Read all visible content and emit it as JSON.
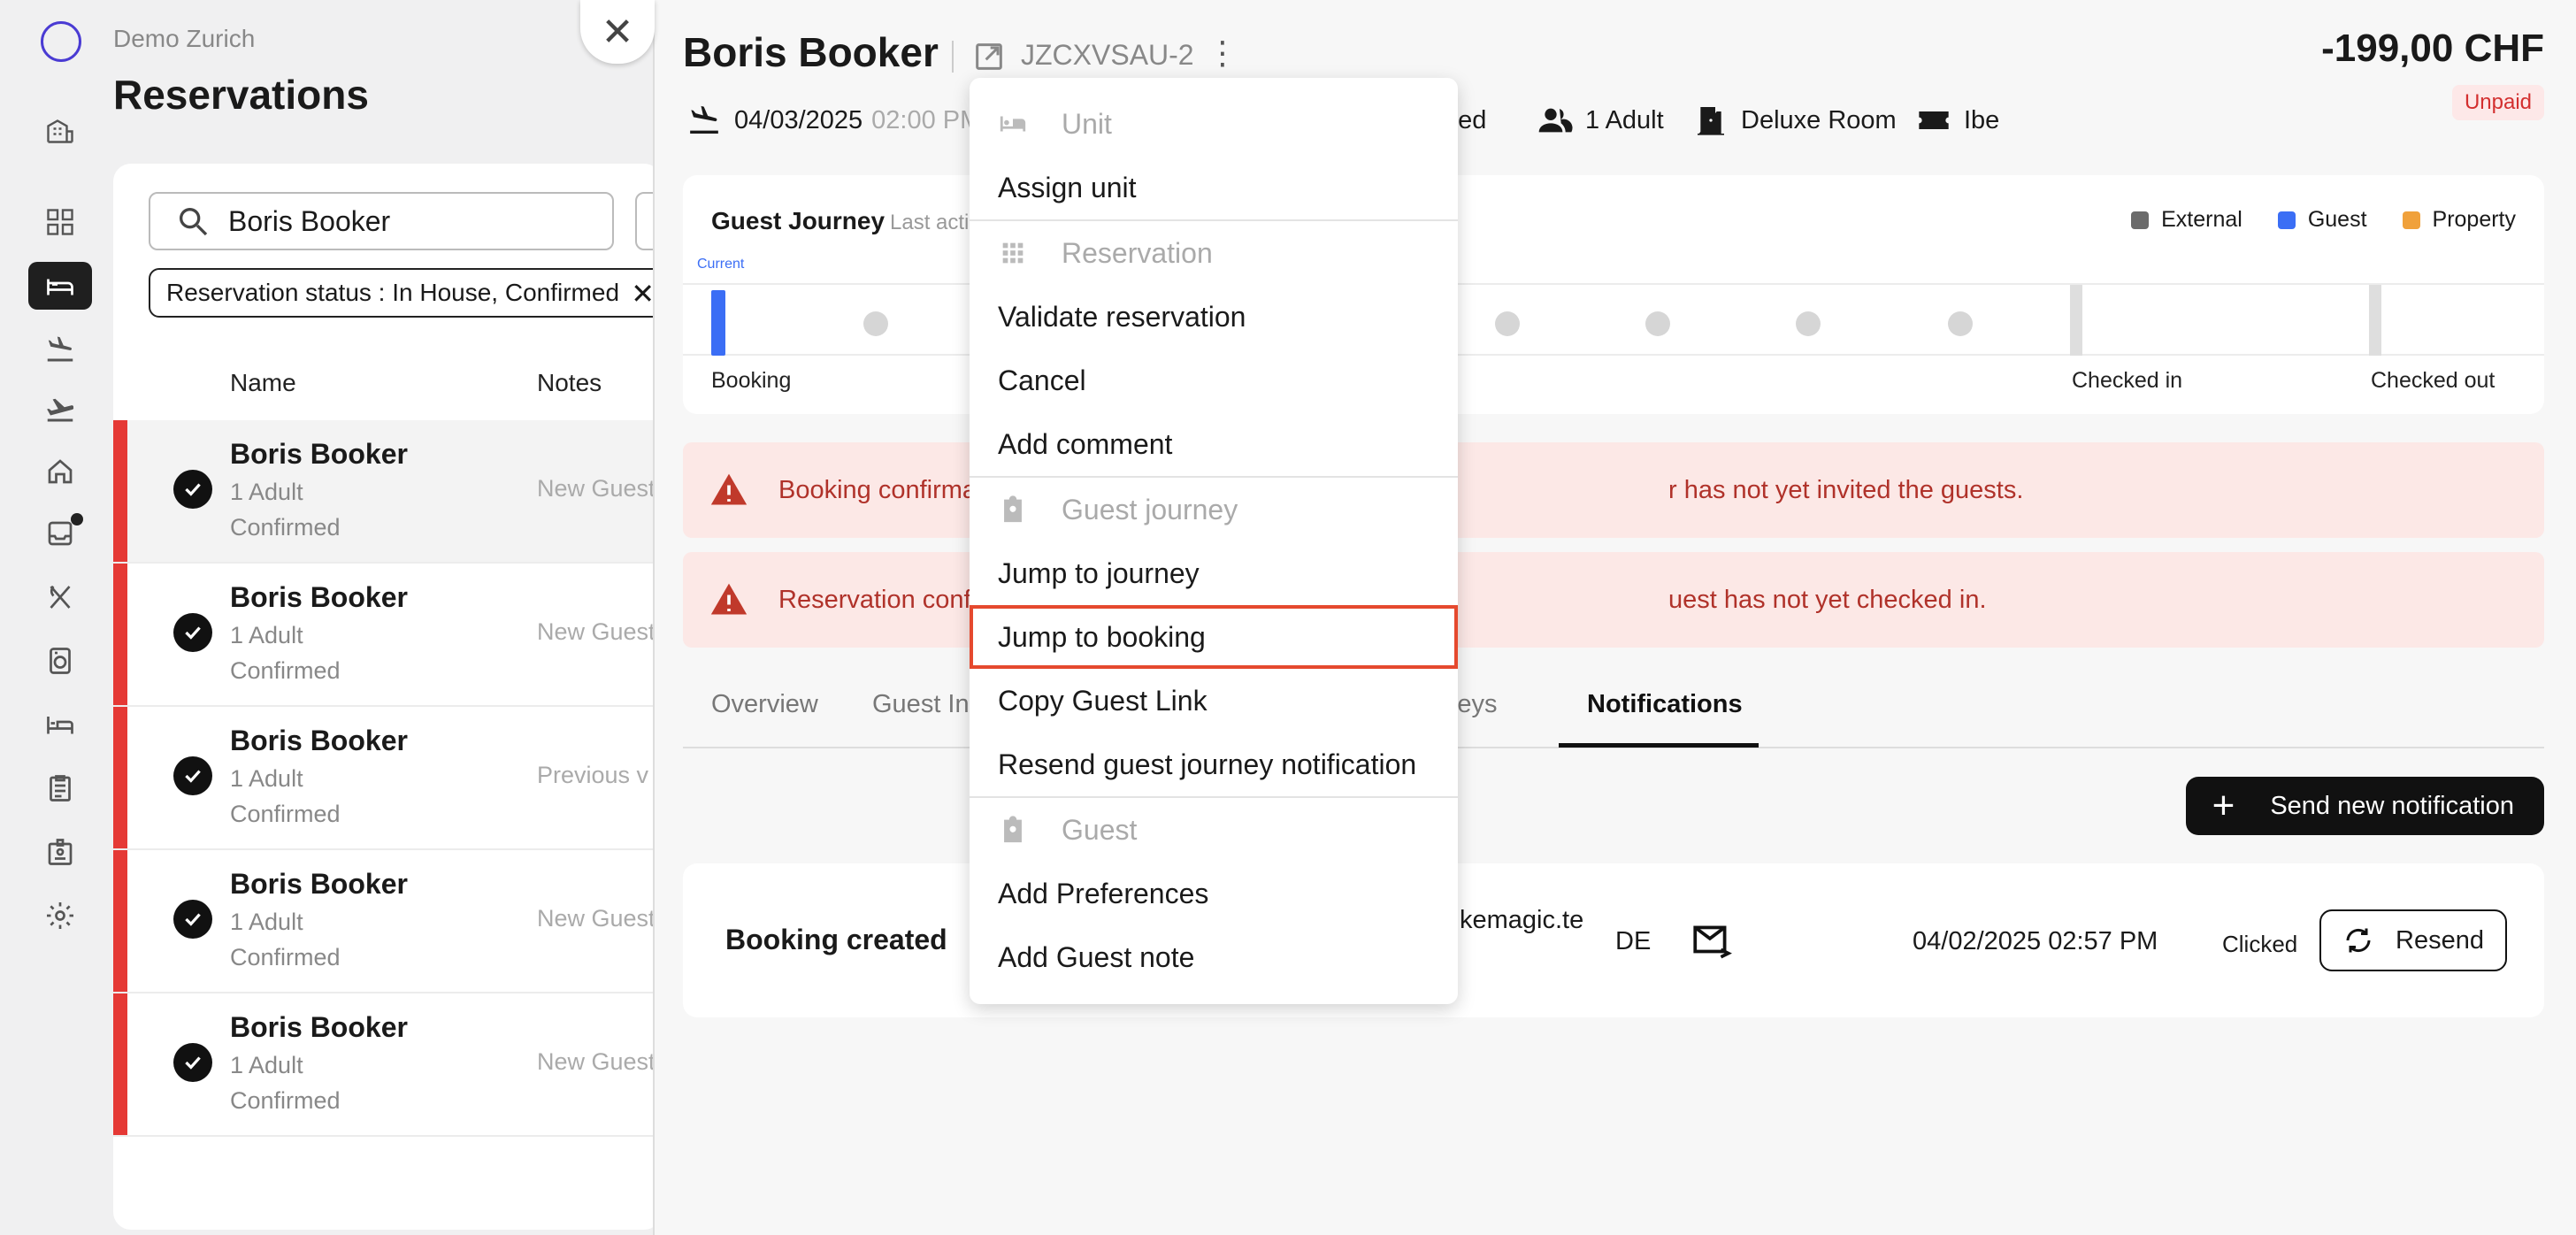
{
  "app": {
    "hotel_name": "Demo Zurich",
    "page_title": "Reservations"
  },
  "rail": {
    "items": [
      "home-icon",
      "grid-icon",
      "bed-icon",
      "arrivals-icon",
      "departures-icon",
      "house-icon",
      "inbox-icon",
      "dining-icon",
      "laundry-icon",
      "rooms-icon",
      "tasks-icon",
      "badge-icon",
      "settings-icon"
    ],
    "active": "bed-icon"
  },
  "list": {
    "search_value": "Boris Booker",
    "filter_chip": "Reservation status : In House, Confirmed",
    "columns": {
      "name": "Name",
      "notes": "Notes"
    },
    "rows": [
      {
        "name": "Boris Booker",
        "guests": "1 Adult",
        "status": "Confirmed",
        "note": "New Guest"
      },
      {
        "name": "Boris Booker",
        "guests": "1 Adult",
        "status": "Confirmed",
        "note": "New Guest"
      },
      {
        "name": "Boris Booker",
        "guests": "1 Adult",
        "status": "Confirmed",
        "note": "Previous v"
      },
      {
        "name": "Boris Booker",
        "guests": "1 Adult",
        "status": "Confirmed",
        "note": "New Guest"
      },
      {
        "name": "Boris Booker",
        "guests": "1 Adult",
        "status": "Confirmed",
        "note": "New Guest"
      }
    ]
  },
  "detail": {
    "guest_name": "Boris Booker",
    "booking_code": "JZCXVSAU-2",
    "amount": "-199,00 CHF",
    "payment_status": "Unpaid",
    "arrival_date": "04/03/2025",
    "arrival_time": "02:00 PM",
    "status_partial": "med",
    "adults": "1 Adult",
    "room_type": "Deluxe Room",
    "channel": "Ibe"
  },
  "journey": {
    "title": "Guest Journey",
    "subtitle_partial": "Last acti",
    "legend": [
      {
        "label": "External",
        "color": "#6b6b6b"
      },
      {
        "label": "Guest",
        "color": "#3b6ef5"
      },
      {
        "label": "Property",
        "color": "#f0a13b"
      }
    ],
    "current_label": "Current",
    "stages": {
      "booking": "Booking",
      "checked_in": "Checked in",
      "checked_out": "Checked out"
    }
  },
  "alerts": [
    {
      "left": "Booking confirma",
      "right": "r has not yet invited the guests."
    },
    {
      "left": "Reservation confi",
      "right": "uest has not yet checked in."
    }
  ],
  "tabs": {
    "overview": "Overview",
    "guest_ins": "Guest Ins",
    "keys": "Keys",
    "notifications": "Notifications"
  },
  "notifications": {
    "send_button": "Send new notification",
    "item": {
      "title": "Booking created",
      "email_partial": "kemagic.te",
      "language": "DE",
      "date": "04/02/2025 02:57 PM",
      "status": "Clicked",
      "resend_label": "Resend"
    }
  },
  "menu": {
    "sections": [
      {
        "header": "Unit",
        "icon": "bed-icon",
        "items": [
          "Assign unit"
        ]
      },
      {
        "header": "Reservation",
        "icon": "grid-dots-icon",
        "items": [
          "Validate reservation",
          "Cancel",
          "Add comment"
        ]
      },
      {
        "header": "Guest journey",
        "icon": "clipboard-person-icon",
        "items": [
          "Jump to journey",
          "Jump to booking",
          "Copy Guest Link",
          "Resend guest journey notification"
        ]
      },
      {
        "header": "Guest",
        "icon": "clipboard-person-icon",
        "items": [
          "Add Preferences",
          "Add Guest note"
        ]
      }
    ],
    "highlighted": "Jump to booking"
  },
  "colors": {
    "accent_red": "#e53935",
    "alert_bg": "#fce8e6",
    "alert_text": "#b0322a",
    "current_blue": "#3b6ef5",
    "highlight_outline": "#e5492e"
  }
}
